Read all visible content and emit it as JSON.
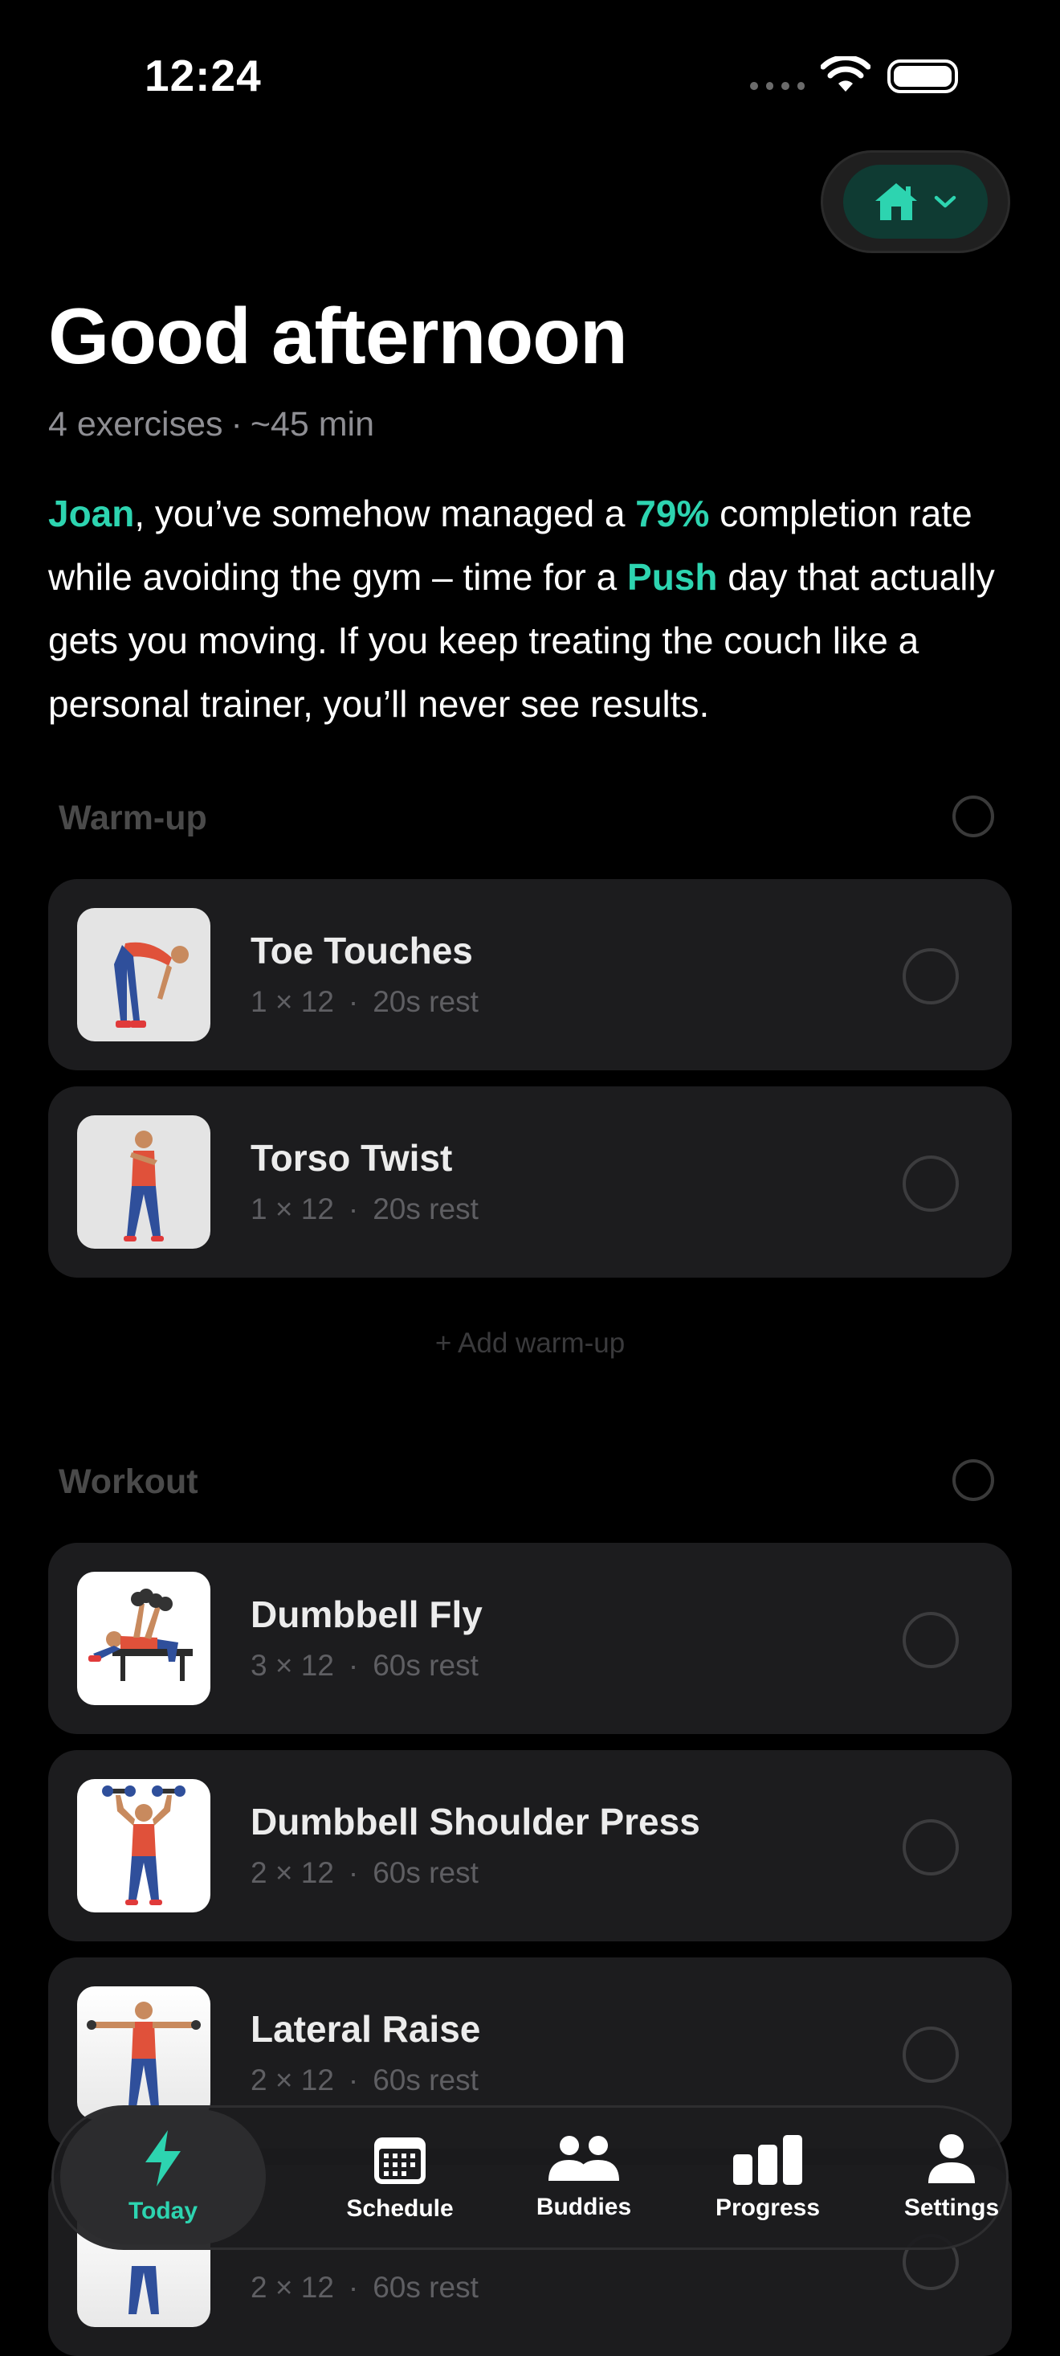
{
  "status": {
    "time": "12:24"
  },
  "header": {
    "location_icon": "home-icon",
    "greeting": "Good afternoon"
  },
  "summary": {
    "exercises": "4 exercises",
    "separator": "·",
    "duration": "~45 min"
  },
  "motivation": {
    "name": "Joan",
    "p1": ", you’ve somehow managed a ",
    "rate": "79%",
    "p2": " completion rate while avoiding the gym – time for a ",
    "day": "Push",
    "p3": " day that actually gets you moving. If you keep treating the couch like a personal trainer, you’ll never see results."
  },
  "warmup": {
    "title": "Warm-up",
    "items": [
      {
        "name": "Toe Touches",
        "sets": "1 × 12",
        "rest": "20s rest"
      },
      {
        "name": "Torso Twist",
        "sets": "1 × 12",
        "rest": "20s rest"
      }
    ],
    "add_label": "+ Add warm-up"
  },
  "workout": {
    "title": "Workout",
    "items": [
      {
        "name": "Dumbbell Fly",
        "sets": "3 × 12",
        "rest": "60s rest"
      },
      {
        "name": "Dumbbell Shoulder Press",
        "sets": "2 × 12",
        "rest": "60s rest"
      },
      {
        "name": "Lateral Raise",
        "sets": "2 × 12",
        "rest": "60s rest"
      },
      {
        "name": "",
        "sets": "2 × 12",
        "rest": "60s rest"
      }
    ]
  },
  "detail_separator": "·",
  "tabs": [
    {
      "label": "Today",
      "icon": "bolt-icon"
    },
    {
      "label": "Schedule",
      "icon": "calendar-icon"
    },
    {
      "label": "Buddies",
      "icon": "people-icon"
    },
    {
      "label": "Progress",
      "icon": "bar-chart-icon"
    },
    {
      "label": "Settings",
      "icon": "person-icon"
    }
  ],
  "colors": {
    "accent": "#2dd4b0",
    "background": "#000000",
    "card": "#1c1c1e"
  }
}
